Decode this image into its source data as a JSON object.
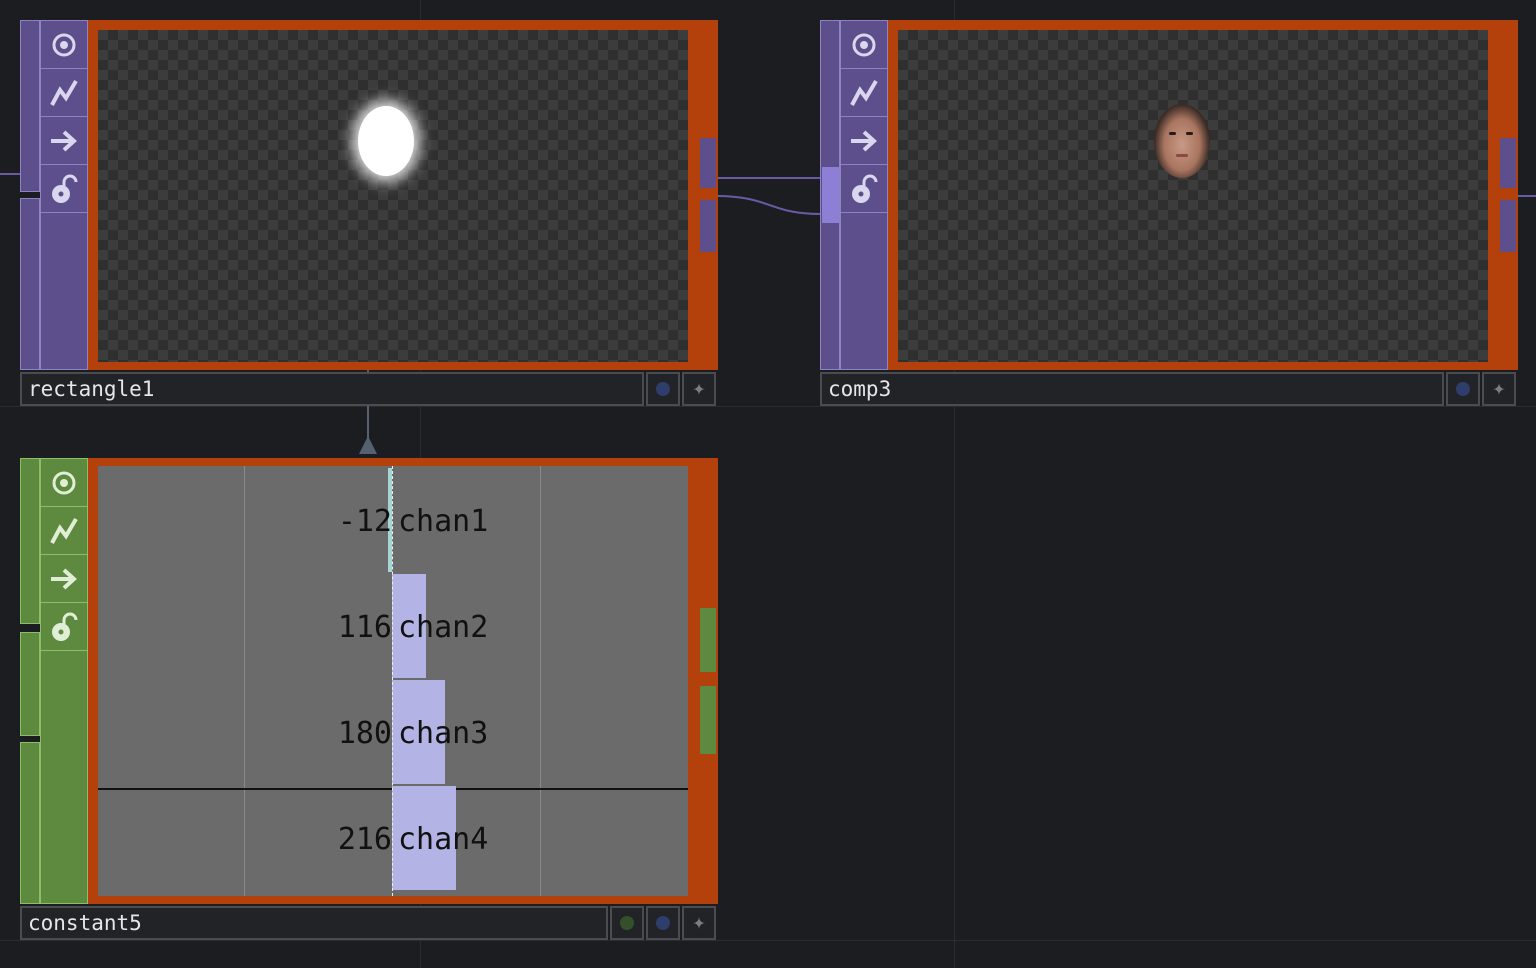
{
  "colors": {
    "background": "#1c1d20",
    "top_node_border": "#b4400b",
    "top_node_purple": "#5c4f8c",
    "chop_green": "#5d8a3e",
    "bar_negative": "#a6d6d3",
    "bar_positive": "#b3b3e6"
  },
  "nodes": {
    "rectangle1": {
      "name": "rectangle1",
      "family": "TOP",
      "preview": "white blurred ellipse on transparent background",
      "icons": [
        "viewer-icon",
        "bypass-icon",
        "export-icon",
        "lock-icon"
      ]
    },
    "comp3": {
      "name": "comp3",
      "family": "TOP",
      "preview": "face composited inside ellipse mask",
      "icons": [
        "viewer-icon",
        "bypass-icon",
        "export-icon",
        "lock-icon"
      ]
    },
    "constant5": {
      "name": "constant5",
      "family": "CHOP",
      "icons": [
        "viewer-icon",
        "bypass-icon",
        "export-icon",
        "lock-icon"
      ],
      "channels": [
        {
          "name": "chan1",
          "value": "-12",
          "num": -12
        },
        {
          "name": "chan2",
          "value": "116",
          "num": 116
        },
        {
          "name": "chan3",
          "value": "180",
          "num": 180
        },
        {
          "name": "chan4",
          "value": "216",
          "num": 216
        }
      ]
    }
  }
}
